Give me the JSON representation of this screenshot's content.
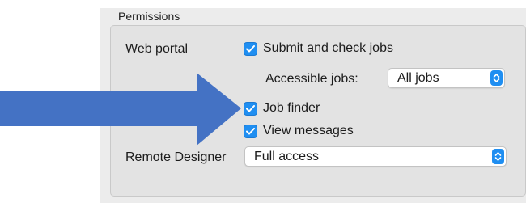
{
  "section": {
    "title": "Permissions"
  },
  "web_portal": {
    "label": "Web portal",
    "submit_check": {
      "label": "Submit and check jobs",
      "checked": true
    },
    "accessible_jobs": {
      "label": "Accessible jobs:",
      "value": "All jobs"
    },
    "job_finder": {
      "label": "Job finder",
      "checked": true
    },
    "view_messages": {
      "label": "View messages",
      "checked": true
    }
  },
  "remote_designer": {
    "label": "Remote Designer",
    "value": "Full access"
  },
  "colors": {
    "accent": "#1f8ef1",
    "arrow": "#4472c4",
    "panel": "#ececec"
  },
  "icons": {
    "checkbox_mark": "checkmark-icon",
    "select": "chevron-updown-icon",
    "pointer": "arrow-right-icon"
  }
}
